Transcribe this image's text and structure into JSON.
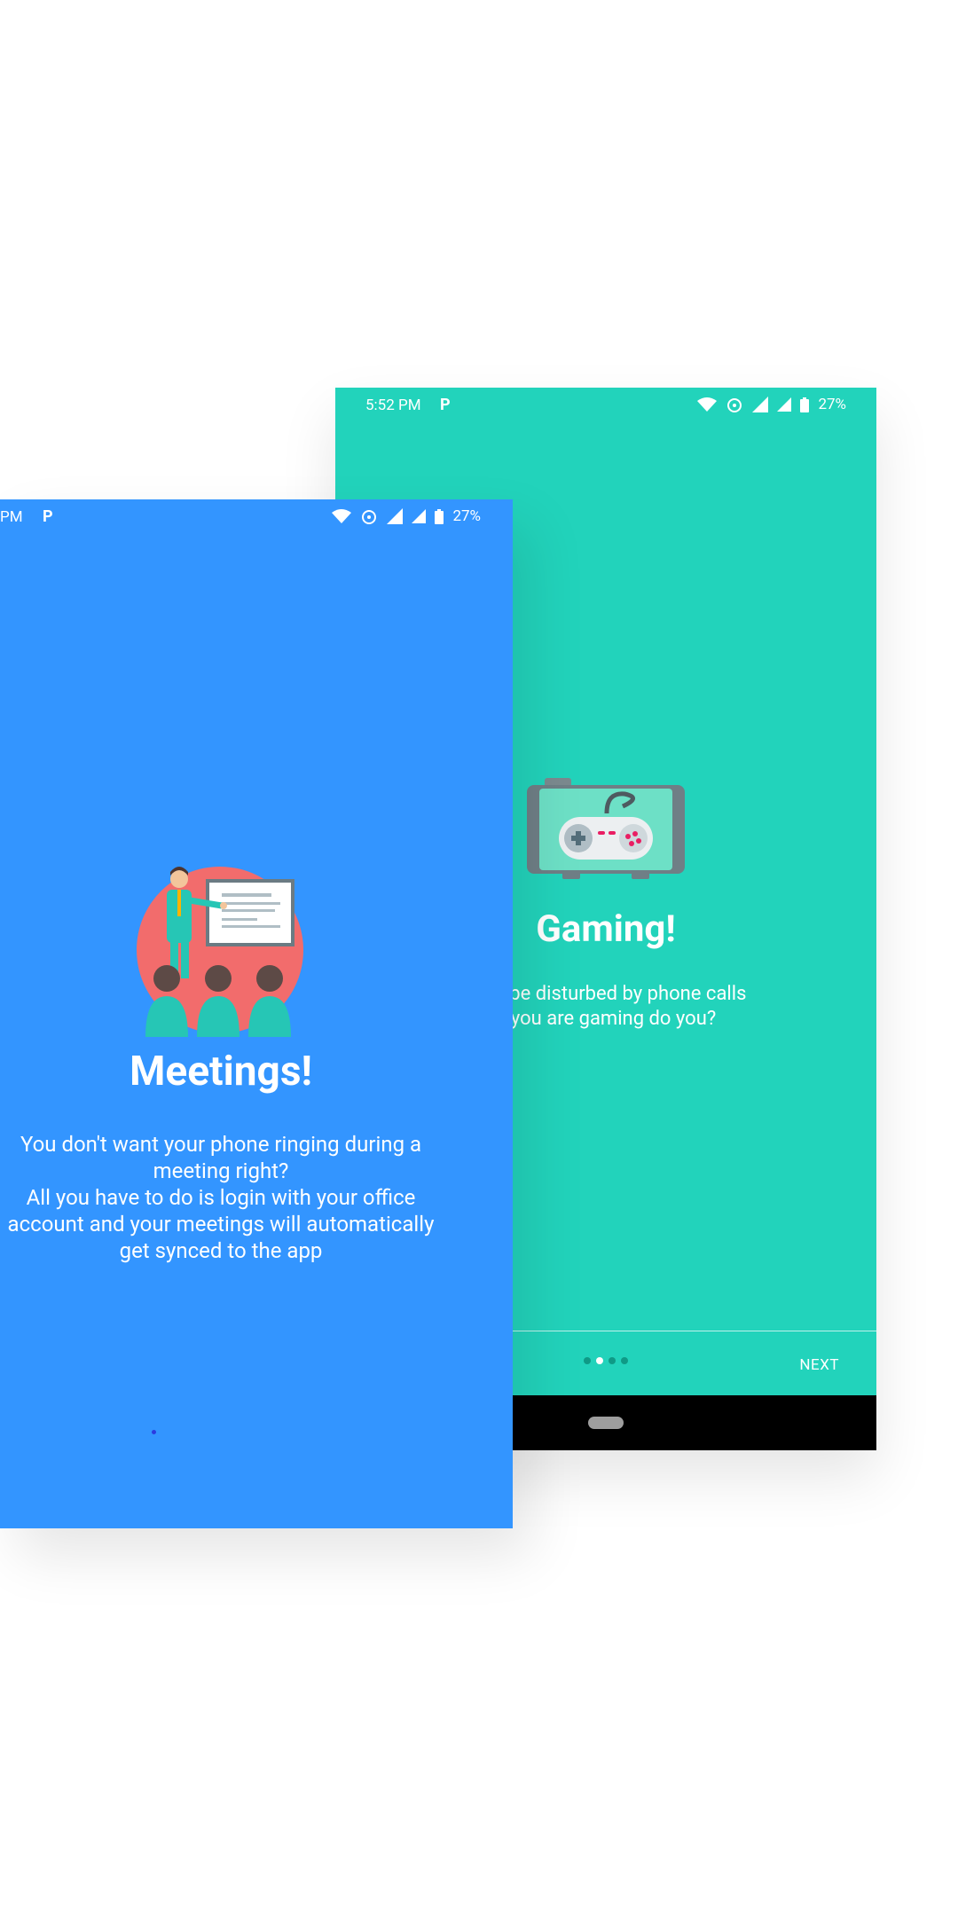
{
  "back_screen": {
    "status_bar": {
      "time": "5:52 PM",
      "battery": "27%"
    },
    "title": "Gaming!",
    "description_line1": "nt to be disturbed by phone calls",
    "description_line2": "e you are gaming do you?",
    "next_label": "NEXT",
    "page_indicator": {
      "count": 4,
      "active_index": 1
    },
    "colors": {
      "background": "#22d3bb"
    },
    "illustration_icon": "gamepad-icon"
  },
  "front_screen": {
    "status_bar": {
      "time": "PM",
      "battery": "27%"
    },
    "title": "Meetings!",
    "description_line1": "You don't want your phone ringing during a",
    "description_line2": "meeting right?",
    "description_line3": "All you have to do is login with your office",
    "description_line4": "account and your meetings will automatically",
    "description_line5": "get synced to the app",
    "colors": {
      "background": "#3395ff"
    },
    "illustration_icon": "presentation-meeting-icon"
  }
}
